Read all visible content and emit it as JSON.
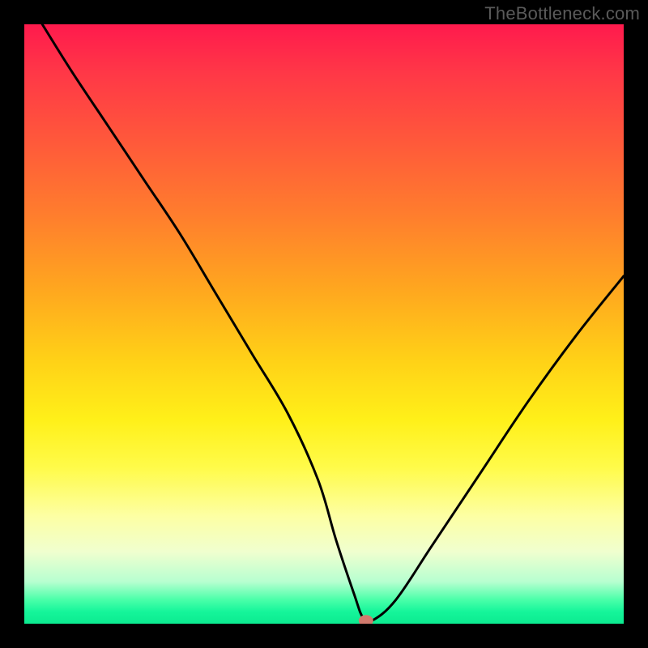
{
  "watermark": "TheBottleneck.com",
  "chart_data": {
    "type": "line",
    "title": "",
    "xlabel": "",
    "ylabel": "",
    "xlim": [
      0,
      100
    ],
    "ylim": [
      0,
      100
    ],
    "x": [
      3,
      8,
      14,
      20,
      26,
      32,
      38,
      44,
      49,
      52,
      55,
      56.5,
      58,
      62,
      68,
      76,
      84,
      92,
      100
    ],
    "values": [
      100,
      92,
      83,
      74,
      65,
      55,
      45,
      35,
      24,
      14,
      5,
      1,
      0.5,
      4,
      13,
      25,
      37,
      48,
      58
    ],
    "marker": {
      "x": 57,
      "y": 0.5,
      "color": "#d17a6d"
    },
    "background_gradient": {
      "direction": "vertical",
      "stops": [
        {
          "pos": 0,
          "color": "#ff1a4d"
        },
        {
          "pos": 50,
          "color": "#ffc31a"
        },
        {
          "pos": 75,
          "color": "#fffb4a"
        },
        {
          "pos": 100,
          "color": "#0ceb90"
        }
      ]
    }
  }
}
